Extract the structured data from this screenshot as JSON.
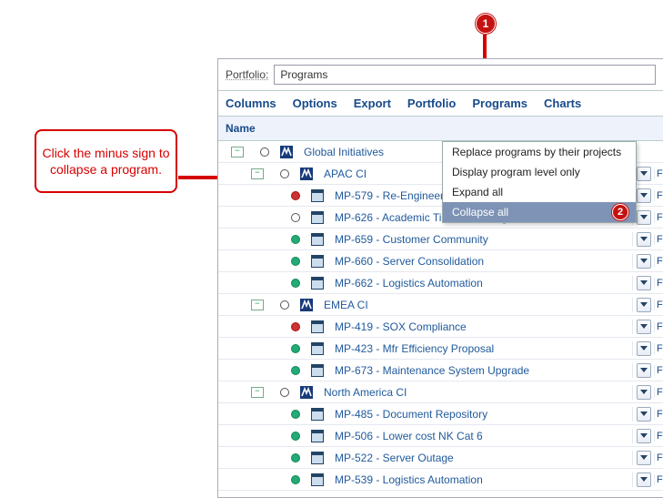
{
  "callout_text": "Click the minus sign to collapse a program.",
  "badge1": "1",
  "badge2": "2",
  "portfolio": {
    "label": "Portfolio:",
    "value": "Programs"
  },
  "menubar": [
    "Columns",
    "Options",
    "Export",
    "Portfolio",
    "Programs",
    "Charts"
  ],
  "header": "Name",
  "dropdown": {
    "items": [
      "Replace programs by their projects",
      "Display program level only",
      "Expand all",
      "Collapse all"
    ],
    "selected_index": 3
  },
  "colB_char": "F",
  "rows": [
    {
      "indent": 0,
      "toggle": "-",
      "status": "none",
      "kind": "program",
      "label": "Global Initiatives",
      "dd": false,
      "b": false
    },
    {
      "indent": 1,
      "toggle": "-",
      "status": "none",
      "kind": "program",
      "label": "APAC CI",
      "dd": true,
      "b": true
    },
    {
      "indent": 3,
      "toggle": null,
      "status": "red",
      "kind": "project",
      "label": "MP-579 - Re-Engineer Imaging Software",
      "dd": true,
      "b": true
    },
    {
      "indent": 3,
      "toggle": null,
      "status": "none",
      "kind": "project",
      "label": "MP-626 - Academic Timetable Integration With Office",
      "dd": true,
      "b": true
    },
    {
      "indent": 3,
      "toggle": null,
      "status": "green",
      "kind": "project",
      "label": "MP-659 - Customer Community",
      "dd": true,
      "b": true
    },
    {
      "indent": 3,
      "toggle": null,
      "status": "green",
      "kind": "project",
      "label": "MP-660 - Server Consolidation",
      "dd": true,
      "b": true
    },
    {
      "indent": 3,
      "toggle": null,
      "status": "green",
      "kind": "project",
      "label": "MP-662 - Logistics Automation",
      "dd": true,
      "b": true
    },
    {
      "indent": 1,
      "toggle": "-",
      "status": "none",
      "kind": "program",
      "label": "EMEA CI",
      "dd": true,
      "b": true
    },
    {
      "indent": 3,
      "toggle": null,
      "status": "red",
      "kind": "project",
      "label": "MP-419 - SOX Compliance",
      "dd": true,
      "b": true
    },
    {
      "indent": 3,
      "toggle": null,
      "status": "green",
      "kind": "project",
      "label": "MP-423 - Mfr Efficiency Proposal",
      "dd": true,
      "b": true
    },
    {
      "indent": 3,
      "toggle": null,
      "status": "green",
      "kind": "project",
      "label": "MP-673 - Maintenance System Upgrade",
      "dd": true,
      "b": true
    },
    {
      "indent": 1,
      "toggle": "-",
      "status": "none",
      "kind": "program",
      "label": "North America CI",
      "dd": true,
      "b": true
    },
    {
      "indent": 3,
      "toggle": null,
      "status": "green",
      "kind": "project",
      "label": "MP-485 - Document Repository",
      "dd": true,
      "b": true
    },
    {
      "indent": 3,
      "toggle": null,
      "status": "green",
      "kind": "project",
      "label": "MP-506 - Lower cost NK Cat 6",
      "dd": true,
      "b": true
    },
    {
      "indent": 3,
      "toggle": null,
      "status": "green",
      "kind": "project",
      "label": "MP-522 - Server Outage",
      "dd": true,
      "b": true
    },
    {
      "indent": 3,
      "toggle": null,
      "status": "green",
      "kind": "project",
      "label": "MP-539 - Logistics Automation",
      "dd": true,
      "b": true
    }
  ]
}
